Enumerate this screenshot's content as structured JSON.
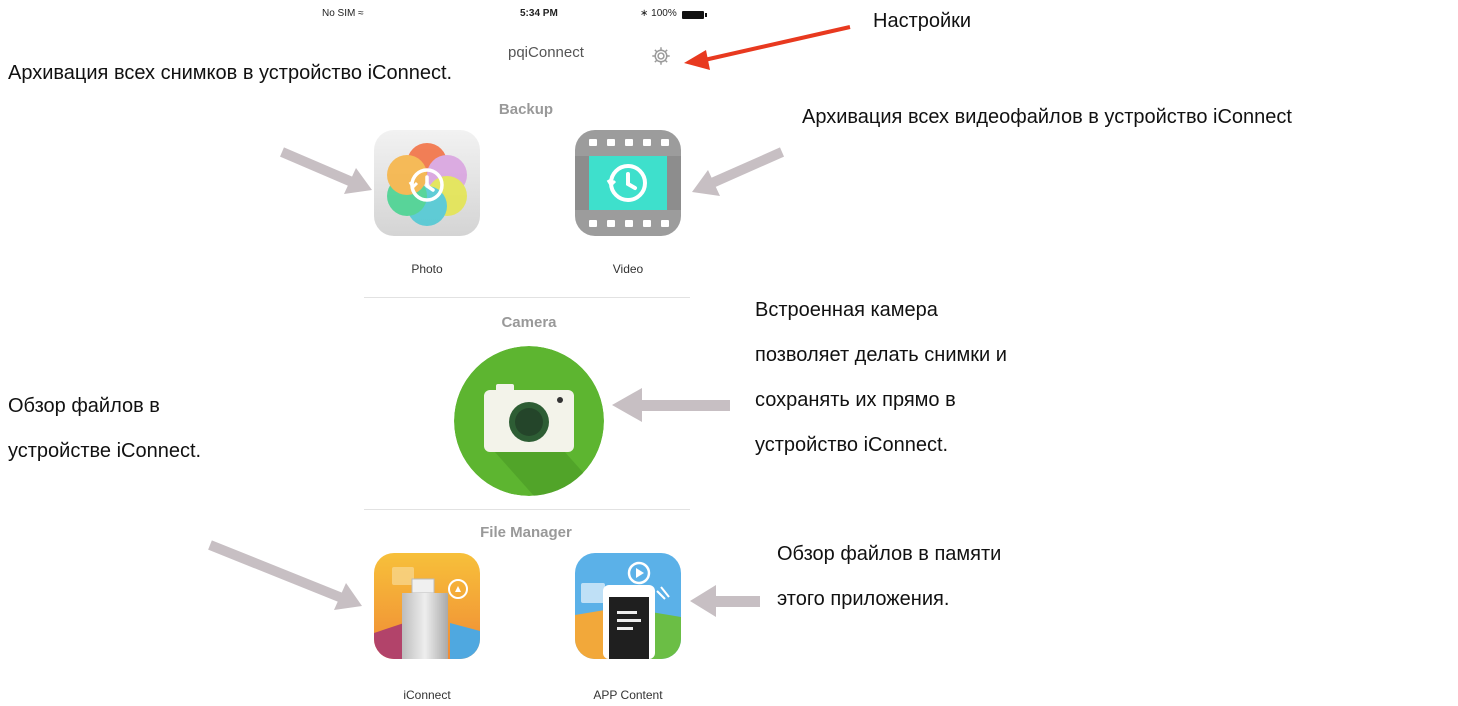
{
  "status_bar": {
    "carrier": "No SIM",
    "wifi_icon": "wifi-icon",
    "time": "5:34 PM",
    "battery": "100%",
    "bluetooth_icon": "bluetooth-icon"
  },
  "app": {
    "title": "pqiConnect",
    "settings_icon": "gear-icon"
  },
  "sections": {
    "backup": {
      "title": "Backup",
      "items": [
        {
          "label": "Photo",
          "icon": "photo-backup-icon"
        },
        {
          "label": "Video",
          "icon": "video-backup-icon"
        }
      ]
    },
    "camera": {
      "title": "Camera",
      "icon": "camera-icon"
    },
    "file_manager": {
      "title": "File Manager",
      "items": [
        {
          "label": "iConnect",
          "icon": "iconnect-drive-icon"
        },
        {
          "label": "APP Content",
          "icon": "app-content-icon"
        }
      ]
    }
  },
  "annotations": {
    "settings": "Настройки",
    "photo_backup": "Архивация всех снимков в устройство iConnect.",
    "video_backup": "Архивация всех видеофайлов в устройство iConnect",
    "camera": [
      "Встроенная камера",
      "позволяет делать снимки и",
      "сохранять их прямо в",
      "устройство iConnect."
    ],
    "iconnect_browse": [
      "Обзор файлов в",
      "устройстве iConnect."
    ],
    "app_content": [
      "Обзор файлов в памяти",
      "этого приложения."
    ]
  },
  "colors": {
    "red_arrow": "#e8391f",
    "gray_arrow": "#c7bfc3",
    "camera_green": "#5db530"
  }
}
